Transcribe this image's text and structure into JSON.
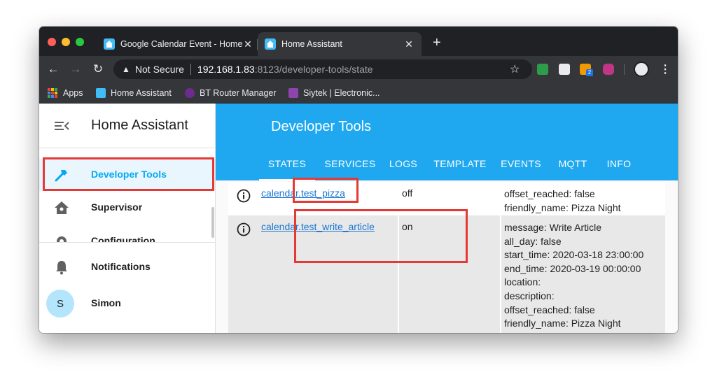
{
  "browser": {
    "tabs": [
      {
        "title": "Google Calendar Event - Home",
        "active": false
      },
      {
        "title": "Home Assistant",
        "active": true
      }
    ],
    "address": {
      "security_label": "Not Secure",
      "host": "192.168.1.83",
      "port": ":8123",
      "path": "/developer-tools/state"
    },
    "bookmarks": [
      {
        "label": "Apps",
        "icon": "apps-grid-icon"
      },
      {
        "label": "Home Assistant",
        "icon": "home-assistant-icon"
      },
      {
        "label": "BT Router Manager",
        "icon": "bt-icon"
      },
      {
        "label": "Siytek | Electronic...",
        "icon": "siytek-icon"
      }
    ],
    "extension_badge": "2"
  },
  "sidebar": {
    "title": "Home Assistant",
    "items": [
      {
        "label": "Developer Tools",
        "icon": "hammer-icon",
        "active": true
      },
      {
        "label": "Supervisor",
        "icon": "supervisor-icon"
      },
      {
        "label": "Configuration",
        "icon": "cog-icon"
      }
    ],
    "notifications_label": "Notifications",
    "user": {
      "name": "Simon",
      "initial": "S"
    }
  },
  "main": {
    "page_title": "Developer Tools",
    "tabs": [
      "STATES",
      "SERVICES",
      "LOGS",
      "TEMPLATE",
      "EVENTS",
      "MQTT",
      "INFO"
    ],
    "selected_tab": "STATES",
    "states": [
      {
        "entity": "calendar.test_pizza",
        "state": "off",
        "attributes": [
          "offset_reached: false",
          "friendly_name: Pizza Night"
        ]
      },
      {
        "entity": "calendar.test_write_article",
        "state": "on",
        "attributes": [
          "message: Write Article",
          "all_day: false",
          "start_time: 2020-03-18 23:00:00",
          "end_time: 2020-03-19 00:00:00",
          "location:",
          "description:",
          "offset_reached: false",
          "friendly_name: Pizza Night"
        ]
      }
    ]
  },
  "colors": {
    "accent": "#03a9f4",
    "header": "#1fa8f0",
    "highlight": "#e53935",
    "link": "#1976d2"
  }
}
